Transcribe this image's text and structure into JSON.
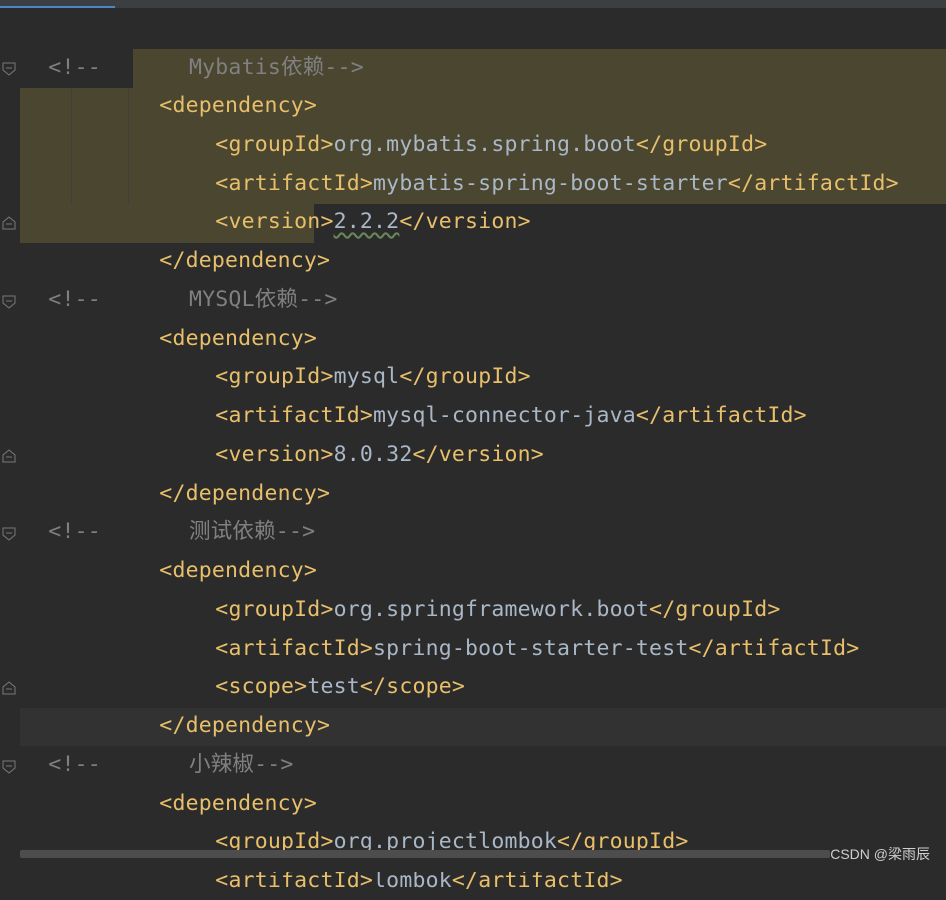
{
  "watermark": "CSDN @梁雨辰",
  "lines": [
    {
      "kind": "comment",
      "open": "<!--",
      "text": "Mybatis依赖-->"
    },
    {
      "kind": "open",
      "text": "<dependency>"
    },
    {
      "kind": "elem",
      "tag_open": "<groupId>",
      "value": "org.mybatis.spring.boot",
      "tag_close": "</groupId>"
    },
    {
      "kind": "elem",
      "tag_open": "<artifactId>",
      "value": "mybatis-spring-boot-starter",
      "tag_close": "</artifactId>"
    },
    {
      "kind": "elem",
      "tag_open": "<version>",
      "value": "2.2.2",
      "tag_close": "</version>"
    },
    {
      "kind": "close",
      "text": "</dependency>"
    },
    {
      "kind": "comment",
      "open": "<!--",
      "text": "MYSQL依赖-->"
    },
    {
      "kind": "open",
      "text": "<dependency>"
    },
    {
      "kind": "elem",
      "tag_open": "<groupId>",
      "value": "mysql",
      "tag_close": "</groupId>"
    },
    {
      "kind": "elem",
      "tag_open": "<artifactId>",
      "value": "mysql-connector-java",
      "tag_close": "</artifactId>"
    },
    {
      "kind": "elem",
      "tag_open": "<version>",
      "value": "8.0.32",
      "tag_close": "</version>"
    },
    {
      "kind": "close",
      "text": "</dependency>"
    },
    {
      "kind": "comment",
      "open": "<!--",
      "text": "测试依赖-->"
    },
    {
      "kind": "open",
      "text": "<dependency>"
    },
    {
      "kind": "elem",
      "tag_open": "<groupId>",
      "value": "org.springframework.boot",
      "tag_close": "</groupId>"
    },
    {
      "kind": "elem",
      "tag_open": "<artifactId>",
      "value": "spring-boot-starter-test",
      "tag_close": "</artifactId>"
    },
    {
      "kind": "elem",
      "tag_open": "<scope>",
      "value": "test",
      "tag_close": "</scope>"
    },
    {
      "kind": "close",
      "text": "</dependency>"
    },
    {
      "kind": "comment",
      "open": "<!--",
      "text": "小辣椒-->"
    },
    {
      "kind": "open",
      "text": "<dependency>"
    },
    {
      "kind": "elem",
      "tag_open": "<groupId>",
      "value": "org.projectlombok",
      "tag_close": "</groupId>"
    },
    {
      "kind": "elem",
      "tag_open": "<artifactId>",
      "value": "lombok",
      "tag_close": "</artifactId>"
    }
  ]
}
